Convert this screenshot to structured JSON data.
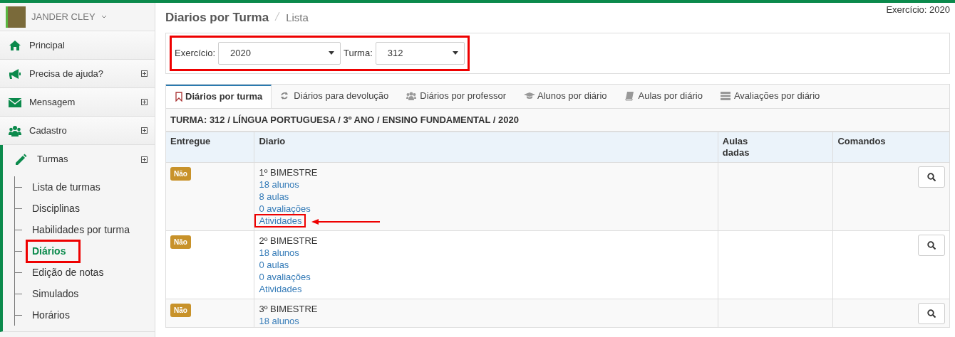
{
  "user": {
    "name": "JANDER CLEY"
  },
  "sidebar": {
    "items": [
      {
        "label": "Principal",
        "expandable": false,
        "expanded": false
      },
      {
        "label": "Precisa de ajuda?",
        "expandable": true,
        "expanded": false
      },
      {
        "label": "Mensagem",
        "expandable": true,
        "expanded": false
      },
      {
        "label": "Cadastro",
        "expandable": true,
        "expanded": false
      },
      {
        "label": "Turmas",
        "expandable": true,
        "expanded": true,
        "children": [
          {
            "label": "Lista de turmas",
            "selected": false,
            "annotated": false
          },
          {
            "label": "Disciplinas",
            "selected": false,
            "annotated": false
          },
          {
            "label": "Habilidades por turma",
            "selected": false,
            "annotated": false
          },
          {
            "label": "Diários",
            "selected": true,
            "annotated": true
          },
          {
            "label": "Edição de notas",
            "selected": false,
            "annotated": false
          },
          {
            "label": "Simulados",
            "selected": false,
            "annotated": false
          },
          {
            "label": "Horários",
            "selected": false,
            "annotated": false
          }
        ]
      }
    ]
  },
  "page": {
    "title": "Diarios por Turma",
    "subtitle": "Lista",
    "exercicio": "Exercício: 2020"
  },
  "filters": {
    "annotated": true,
    "fields": [
      {
        "label": "Exercício:",
        "value": "2020"
      },
      {
        "label": "Turma:",
        "value": "312"
      }
    ]
  },
  "tabs": [
    {
      "label": "Diários por turma",
      "selected": true
    },
    {
      "label": "Diários para devolução",
      "selected": false
    },
    {
      "label": "Diários por professor",
      "selected": false
    },
    {
      "label": "Alunos por diário",
      "selected": false
    },
    {
      "label": "Aulas por diário",
      "selected": false
    },
    {
      "label": "Avaliações por diário",
      "selected": false
    }
  ],
  "caption": "TURMA: 312 / LÍNGUA PORTUGUESA / 3º ANO / ENSINO FUNDAMENTAL / 2020",
  "table": {
    "columns": [
      "Entregue",
      "Diario",
      "Aulas dadas",
      "Comandos"
    ],
    "rows": [
      {
        "entregue": "Não",
        "title": "1º BIMESTRE",
        "links": [
          {
            "text": "18 alunos",
            "annotated": false
          },
          {
            "text": "8 aulas",
            "annotated": false
          },
          {
            "text": "0 avaliações",
            "annotated": false
          },
          {
            "text": "Atividades",
            "annotated": true
          }
        ]
      },
      {
        "entregue": "Não",
        "title": "2º BIMESTRE",
        "links": [
          {
            "text": "18 alunos",
            "annotated": false
          },
          {
            "text": "0 aulas",
            "annotated": false
          },
          {
            "text": "0 avaliações",
            "annotated": false
          },
          {
            "text": "Atividades",
            "annotated": false
          }
        ]
      },
      {
        "entregue": "Não",
        "title": "3º BIMESTRE",
        "links": [
          {
            "text": "18 alunos",
            "annotated": false
          }
        ]
      }
    ]
  }
}
